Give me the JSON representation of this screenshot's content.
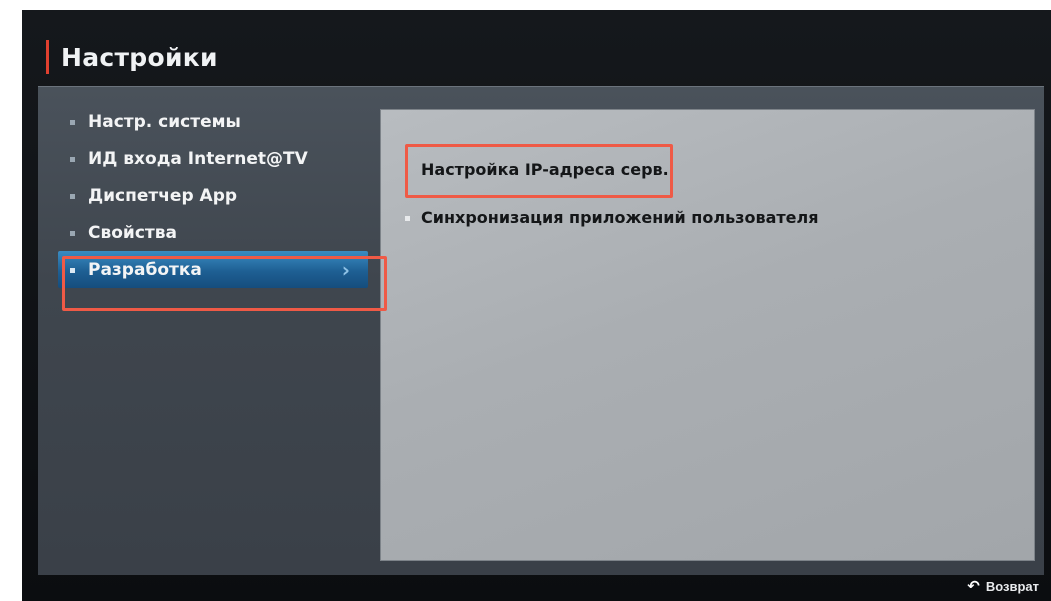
{
  "header": {
    "title": "Настройки"
  },
  "menu": {
    "items": [
      {
        "label": "Настр. системы"
      },
      {
        "label": "ИД входа Internet@TV"
      },
      {
        "label": "Диспетчер App"
      },
      {
        "label": "Свойства"
      },
      {
        "label": "Разработка",
        "selected": true
      }
    ]
  },
  "content": {
    "items": [
      {
        "label": "Настройка IP-адреса серв."
      },
      {
        "label": "Синхронизация приложений пользователя"
      }
    ]
  },
  "footer": {
    "back_label": "Возврат",
    "back_icon": "return-arrow-icon"
  },
  "colors": {
    "accent": "#e0402f",
    "selection": "#1e5f93",
    "annotation": "#ef5a46"
  }
}
